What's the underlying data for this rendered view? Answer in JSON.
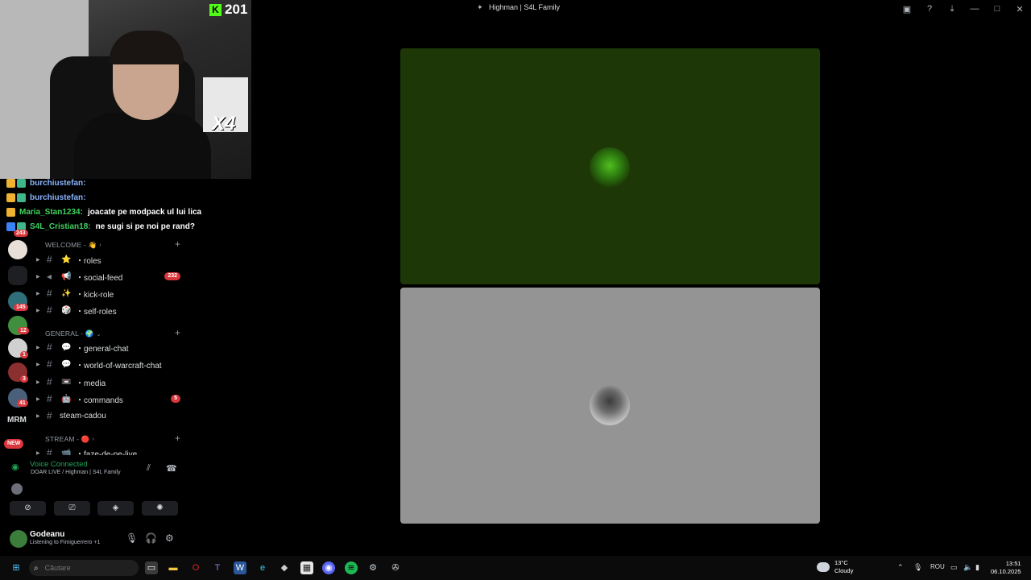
{
  "window": {
    "title": "Highman | S4L Family",
    "controls": [
      "screen-share-icon",
      "help-icon",
      "download-icon",
      "minimize-icon",
      "maximize-icon",
      "close-icon"
    ]
  },
  "overlay": {
    "kick_count": "201",
    "sticker_label": "X4",
    "chat": [
      {
        "user": "burchiustefan:",
        "message": "",
        "color": "#8ab4ff"
      },
      {
        "user": "burchiustefan:",
        "message": "",
        "color": "#8ab4ff"
      },
      {
        "user": "Maria_Stan1234:",
        "message": "joacate pe modpack ul lui lica",
        "color": "#3fd35f"
      },
      {
        "user": "S4L_Cristian18:",
        "message": "ne sugi si pe noi pe rand?",
        "color": "#3fd35f"
      }
    ]
  },
  "servers": {
    "badges": [
      "243",
      "145",
      "12",
      "1",
      "3",
      "41"
    ],
    "mrm_label": "MRM",
    "new_label": "NEW"
  },
  "channels": {
    "categories": [
      {
        "name": "WELCOME - 👋"
      },
      {
        "name": "GENERAL - 🌍"
      },
      {
        "name": "STREAM - 🔴"
      }
    ],
    "items": [
      {
        "emoji": "⭐",
        "label": "・roles",
        "count": ""
      },
      {
        "emoji": "📢",
        "label": "・social-feed",
        "count": "232"
      },
      {
        "emoji": "✨",
        "label": "・kick-role",
        "count": ""
      },
      {
        "emoji": "🎲",
        "label": "・self-roles",
        "count": ""
      },
      {
        "emoji": "💬",
        "label": "・general-chat",
        "count": ""
      },
      {
        "emoji": "💬",
        "label": "・world-of-warcraft-chat",
        "count": ""
      },
      {
        "emoji": "📼",
        "label": "・media",
        "count": ""
      },
      {
        "emoji": "🤖",
        "label": "・commands",
        "count": "5"
      },
      {
        "emoji": "",
        "label": "steam-cadou",
        "count": ""
      },
      {
        "emoji": "📹",
        "label": "・faze-de-pe-live",
        "count": ""
      }
    ]
  },
  "voice": {
    "status": "Voice Connected",
    "location": "DOAR LIVE / Highman | S4L Family"
  },
  "user": {
    "name": "Godeanu",
    "status": "Listening to Fimiguerrero +1"
  },
  "taskbar": {
    "search_placeholder": "Căutare",
    "weather_temp": "13°C",
    "weather_desc": "Cloudy",
    "language": "ROU",
    "time": "13:51",
    "date": "06.10.2025"
  },
  "colors": {
    "tile_top": "#1d3806",
    "tile_bottom": "#949494",
    "discord_red": "#da373c",
    "voice_green": "#23a559"
  }
}
